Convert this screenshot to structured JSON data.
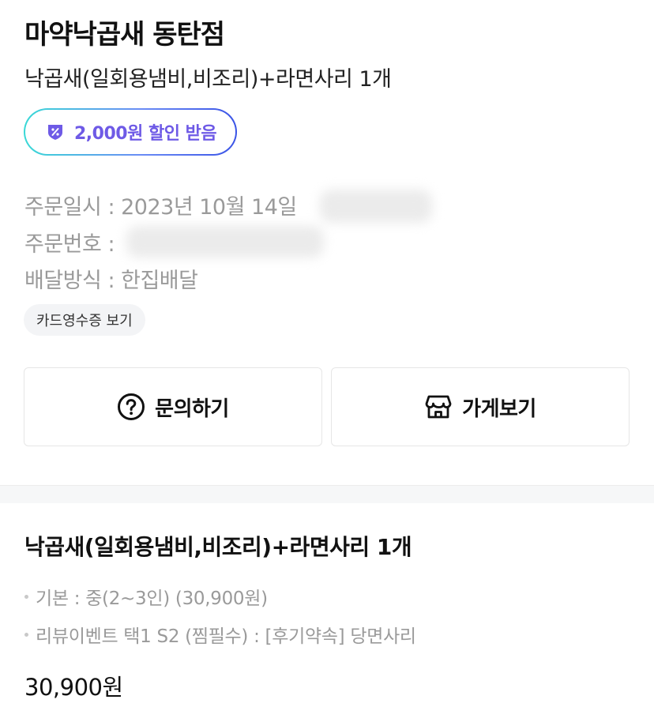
{
  "store": {
    "name": "마약낙곱새 동탄점"
  },
  "order": {
    "summary": "낙곱새(일회용냄비,비조리)+라면사리 1개",
    "coupon_text": "2,000원 할인 받음",
    "date_label": "주문일시 : 2023년 10월 14일",
    "number_label": "주문번호 :",
    "delivery_label": "배달방식 : 한집배달",
    "receipt_button": "카드영수증 보기"
  },
  "actions": {
    "inquiry_label": "문의하기",
    "store_label": "가게보기"
  },
  "menu": {
    "name": "낙곱새(일회용냄비,비조리)+라면사리 1개",
    "options": [
      "기본 : 중(2~3인) (30,900원)",
      "리뷰이벤트 택1 S2 (찜필수) : [후기약속] 당면사리"
    ],
    "price": "30,900원"
  },
  "icons": {
    "coupon": "coupon-badge-icon",
    "inquiry": "question-circle-icon",
    "store": "storefront-icon"
  },
  "colors": {
    "coupon_text": "#6e5ae6",
    "coupon_gradient_start": "#39d9d6",
    "coupon_gradient_end": "#3a53e6",
    "muted_text": "#9a9a9a"
  }
}
